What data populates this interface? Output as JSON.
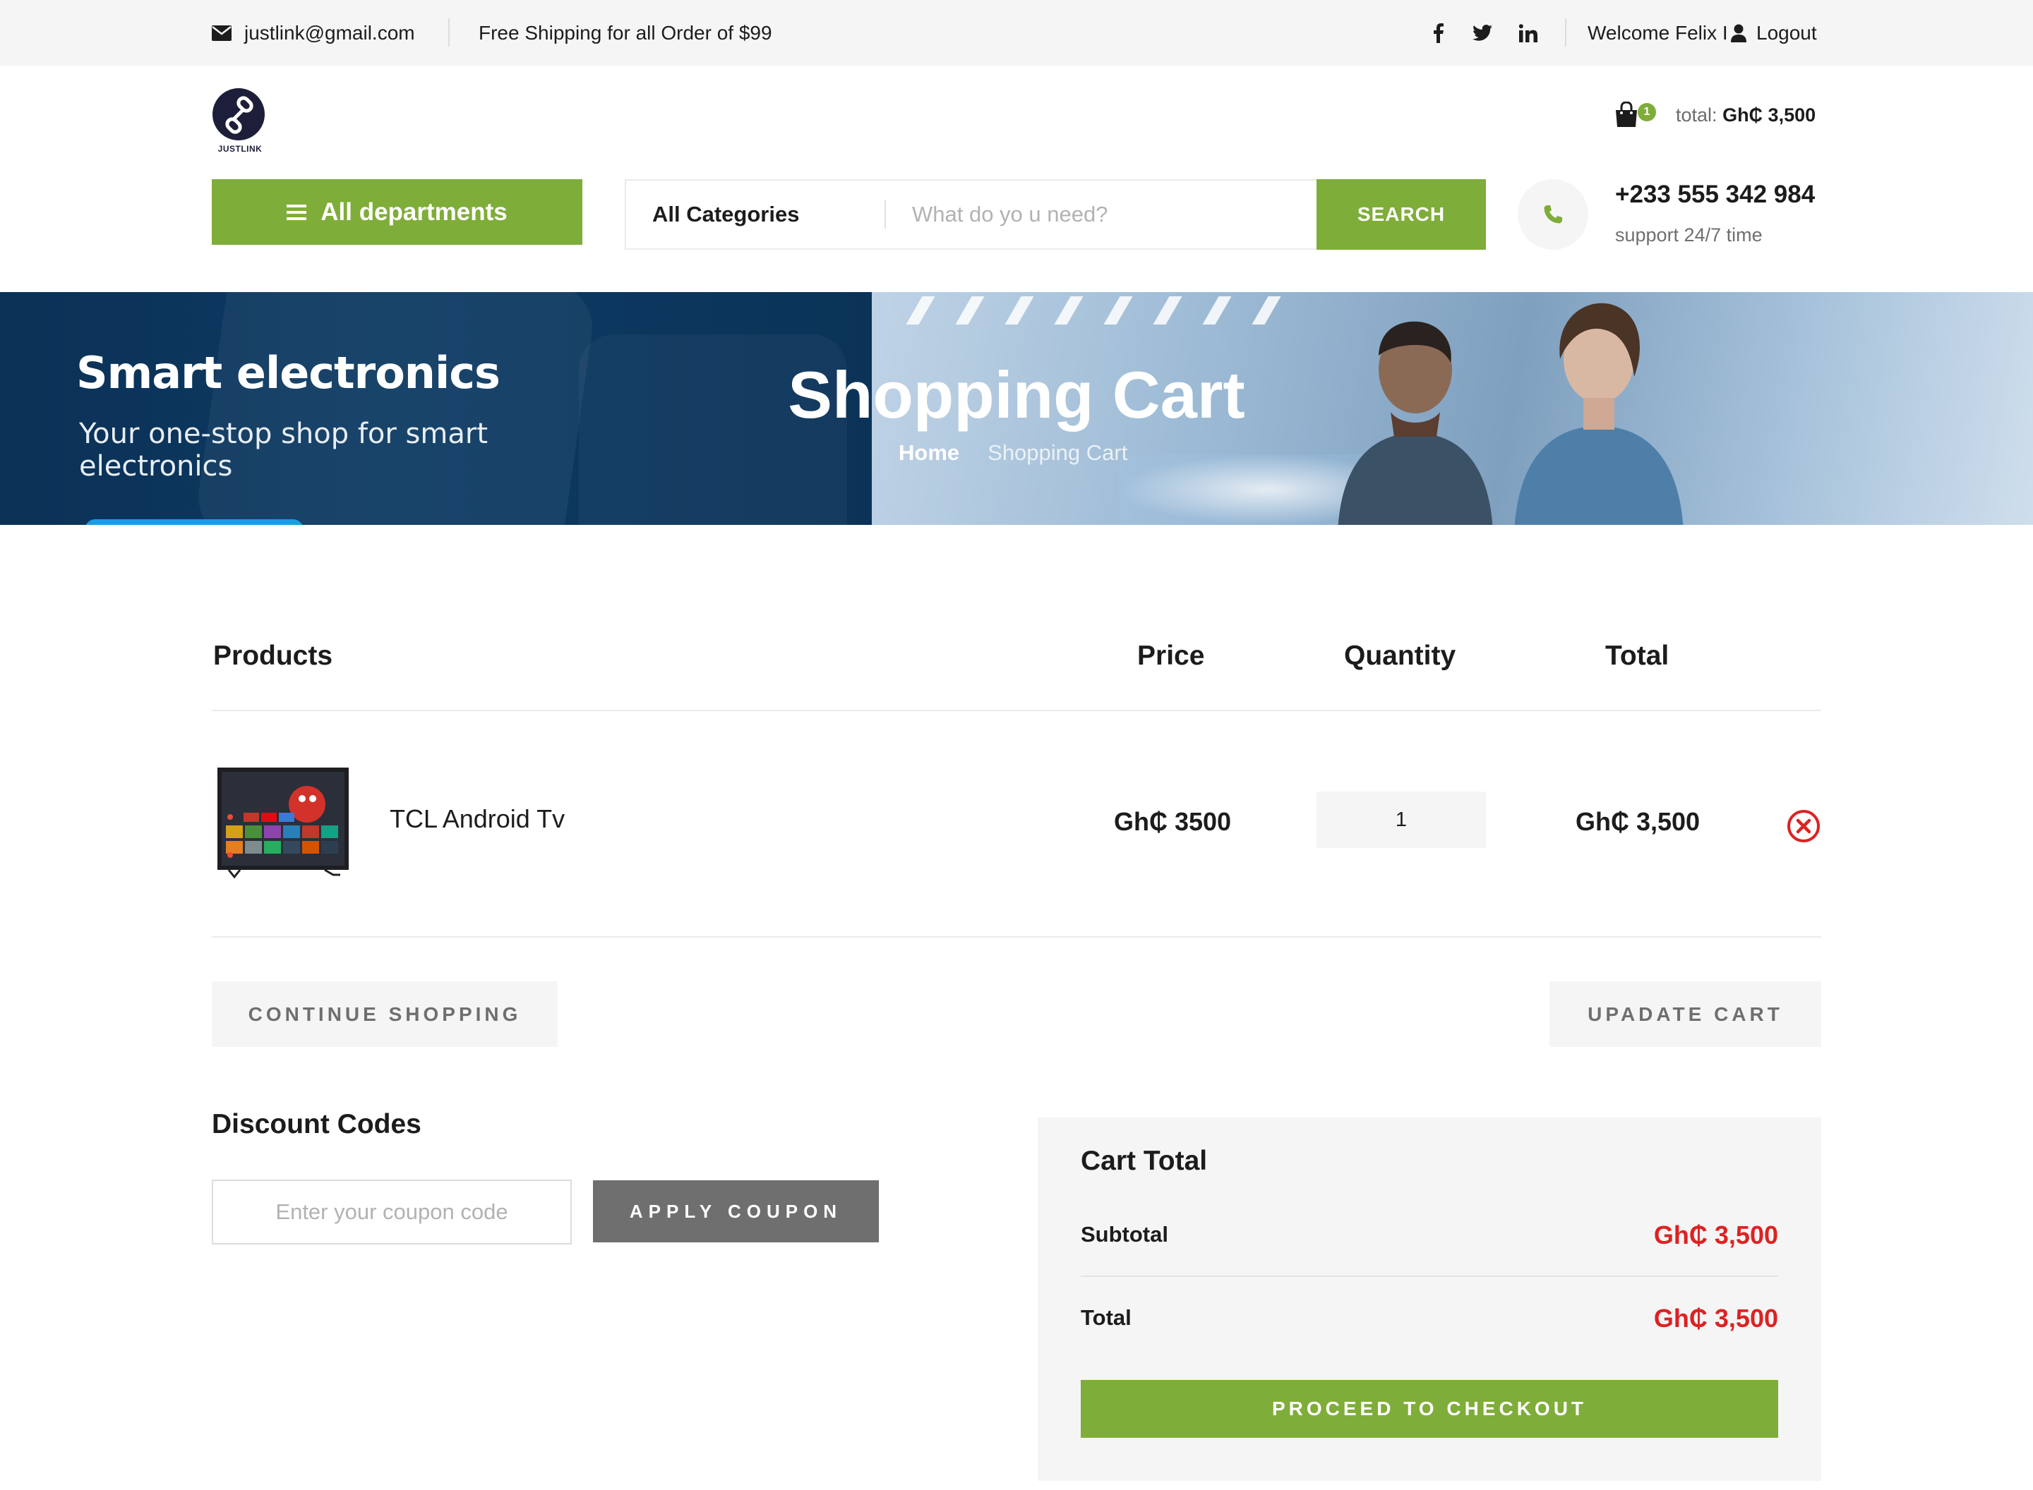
{
  "topbar": {
    "email": "justlink@gmail.com",
    "shipping": "Free Shipping for all Order of $99",
    "social": [
      "f",
      "twitter",
      "in"
    ],
    "welcome": "Welcome Felix I",
    "logout": "Logout"
  },
  "header": {
    "logo_text": "JUSTLINK",
    "cart_count": "1",
    "cart_total_label": "total:",
    "cart_total_value": "Gh₵ 3,500",
    "departments_label": "All departments",
    "search_category": "All Categories",
    "search_placeholder": "What do yo u need?",
    "search_button": "SEARCH",
    "phone": "+233 555 342 984",
    "support": "support 24/7 time"
  },
  "hero": {
    "banner_heading": "Smart electronics",
    "banner_text": "Your one-stop shop for smart electronics",
    "title": "Shopping Cart",
    "breadcrumb_home": "Home",
    "breadcrumb_current": "Shopping Cart"
  },
  "cart": {
    "headers": {
      "products": "Products",
      "price": "Price",
      "quantity": "Quantity",
      "total": "Total"
    },
    "items": [
      {
        "name": "TCL Android Tv",
        "price": "Gh₵ 3500",
        "quantity": "1",
        "total": "Gh₵ 3,500"
      }
    ],
    "continue_label": "CONTINUE SHOPPING",
    "update_label": "UPADATE CART"
  },
  "discount": {
    "heading": "Discount Codes",
    "placeholder": "Enter your coupon code",
    "apply_label": "APPLY COUPON"
  },
  "cart_total": {
    "heading": "Cart Total",
    "subtotal_label": "Subtotal",
    "subtotal_value": "Gh₵ 3,500",
    "total_label": "Total",
    "total_value": "Gh₵ 3,500",
    "checkout_label": "PROCEED TO CHECKOUT"
  },
  "colors": {
    "accent": "#7fad39",
    "price_red": "#dd2222",
    "grey_bg": "#f5f5f5",
    "dark_button": "#6f6f6f"
  }
}
